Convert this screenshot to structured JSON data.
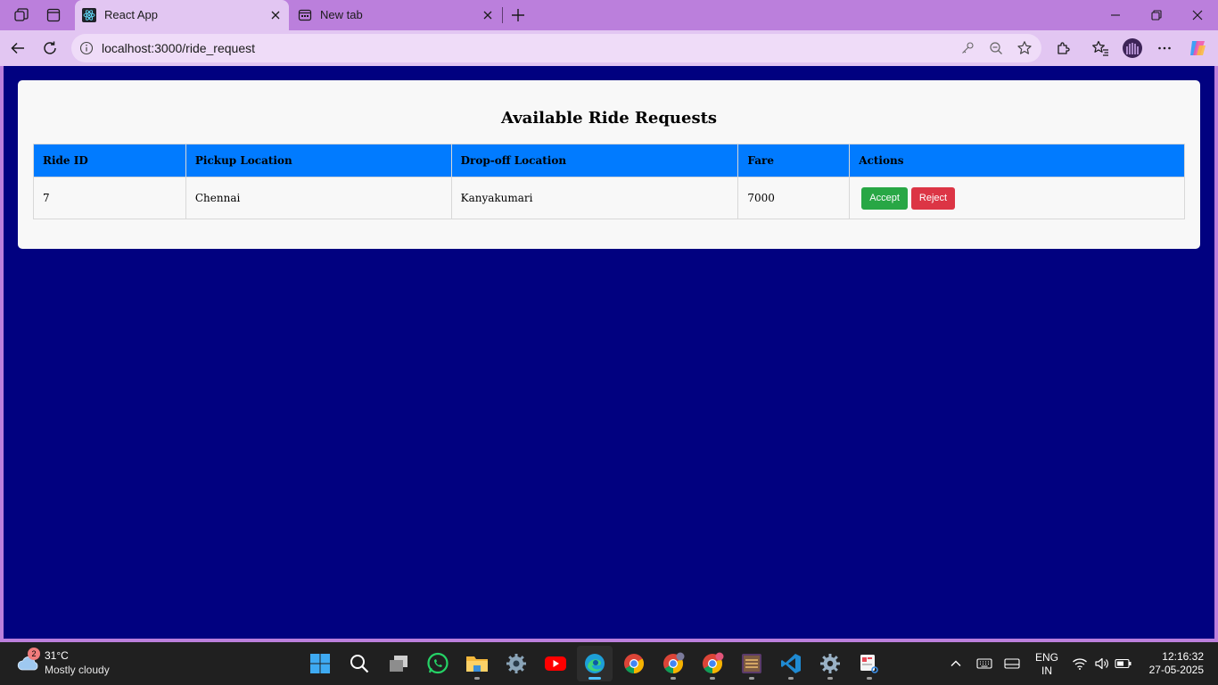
{
  "browser": {
    "tabs": [
      {
        "title": "React App",
        "active": true
      },
      {
        "title": "New tab",
        "active": false
      }
    ],
    "url": "localhost:3000/ride_request"
  },
  "page": {
    "heading": "Available Ride Requests",
    "table": {
      "headers": [
        "Ride ID",
        "Pickup Location",
        "Drop-off Location",
        "Fare",
        "Actions"
      ],
      "rows": [
        {
          "ride_id": "7",
          "pickup": "Chennai",
          "dropoff": "Kanyakumari",
          "fare": "7000"
        }
      ],
      "accept_label": "Accept",
      "reject_label": "Reject"
    },
    "colors": {
      "background": "#010180",
      "header": "#017bff",
      "accept": "#28a745",
      "reject": "#dc3545"
    }
  },
  "taskbar": {
    "weather": {
      "badge": "2",
      "temp": "31°C",
      "condition": "Mostly cloudy"
    },
    "apps": [
      "start-icon",
      "search-icon",
      "task-view-icon",
      "whatsapp-icon",
      "file-explorer-icon",
      "settings-icon",
      "youtube-icon",
      "edge-icon",
      "chrome-icon",
      "chrome-profile-icon",
      "chrome-profile-2-icon",
      "game-icon",
      "vscode-icon",
      "settings-2-icon",
      "snipping-tool-icon"
    ],
    "lang": {
      "line1": "ENG",
      "line2": "IN"
    },
    "clock": {
      "time": "12:16:32",
      "date": "27-05-2025"
    }
  }
}
